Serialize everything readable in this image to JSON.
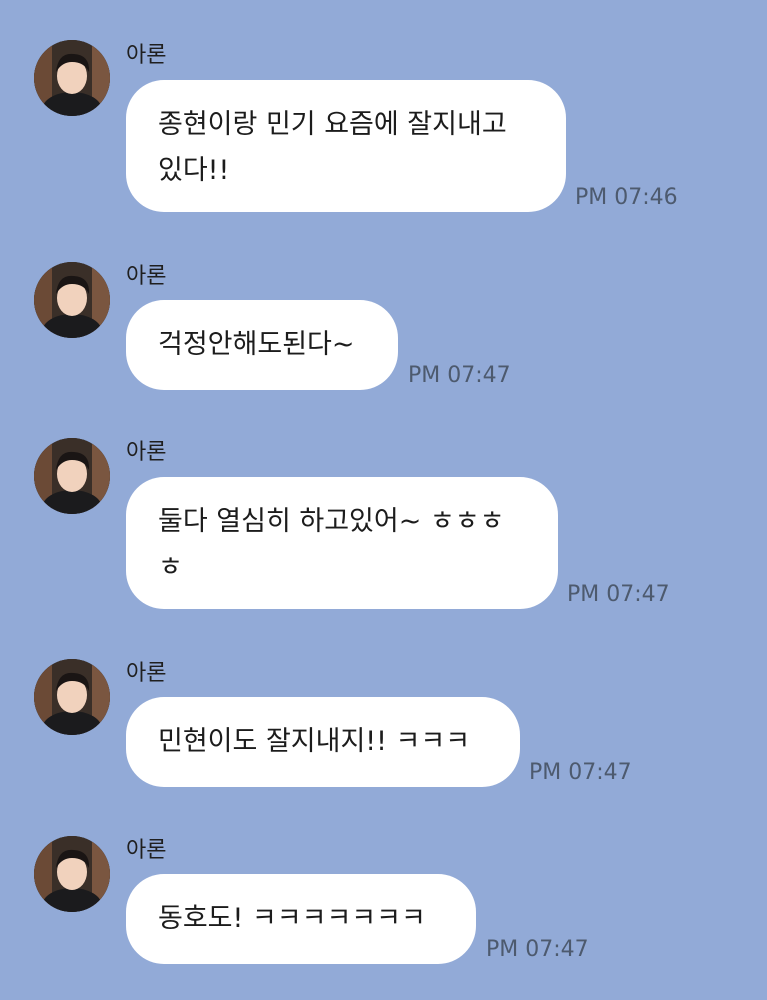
{
  "messages": [
    {
      "sender": "아론",
      "text": "종현이랑 민기 요즘에 잘지내고\n있다!!",
      "time": "PM 07:46"
    },
    {
      "sender": "아론",
      "text": "걱정안해도된다~",
      "time": "PM 07:47"
    },
    {
      "sender": "아론",
      "text": "둘다 열심히 하고있어~ ㅎㅎㅎ\nㅎ",
      "time": "PM 07:47"
    },
    {
      "sender": "아론",
      "text": "민현이도 잘지내지!! ㅋㅋㅋ",
      "time": "PM 07:47"
    },
    {
      "sender": "아론",
      "text": "동호도! ㅋㅋㅋㅋㅋㅋㅋ",
      "time": "PM 07:47"
    }
  ],
  "colors": {
    "background": "#92aad7",
    "bubble": "#ffffff",
    "time_text": "#4d5a6e"
  }
}
